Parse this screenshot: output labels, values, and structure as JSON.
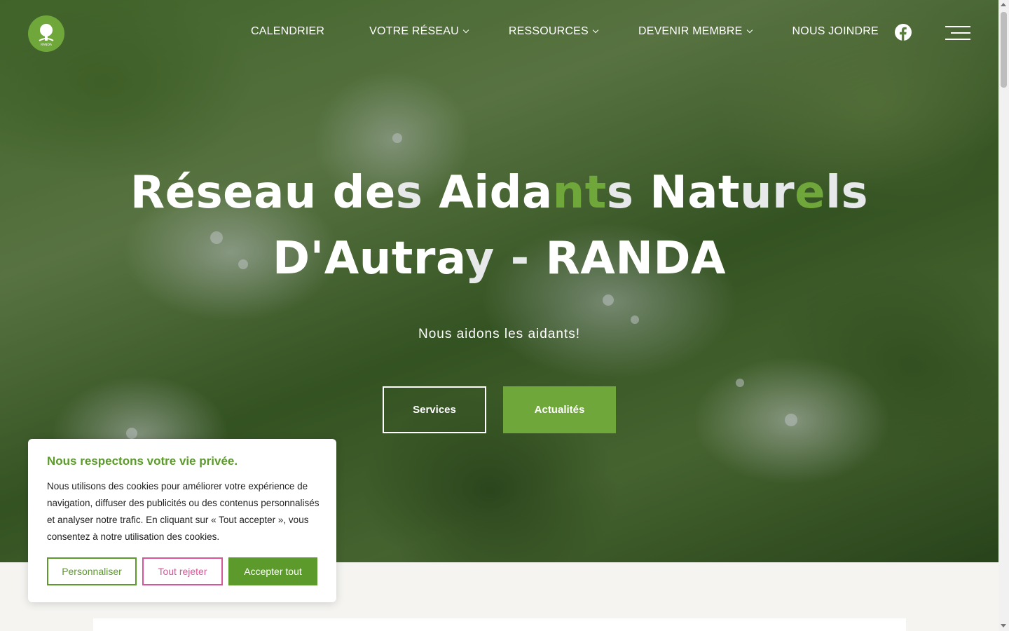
{
  "header": {
    "logo_text": "RANDA",
    "nav": [
      {
        "label": "CALENDRIER",
        "dropdown": false
      },
      {
        "label": "VOTRE RÉSEAU",
        "dropdown": true
      },
      {
        "label": "RESSOURCES",
        "dropdown": true
      },
      {
        "label": "DEVENIR MEMBRE",
        "dropdown": true
      },
      {
        "label": "NOUS JOINDRE",
        "dropdown": false
      }
    ],
    "facebook_icon": "facebook-icon",
    "menu_icon": "hamburger-menu-icon"
  },
  "hero": {
    "title_line1": "Réseau des Aidants Naturels",
    "title_line2": "D'Autray - RANDA",
    "subtitle": "Nous aidons les aidants!",
    "button_services": "Services",
    "button_actualites": "Actualités"
  },
  "cookie": {
    "title": "Nous respectons votre vie privée.",
    "text": "Nous utilisons des cookies pour améliorer votre expérience de navigation, diffuser des publicités ou des contenus personnalisés et analyser notre trafic. En cliquant sur « Tout accepter », vous consentez à notre utilisation des cookies.",
    "customize": "Personnaliser",
    "reject": "Tout rejeter",
    "accept": "Accepter tout"
  },
  "colors": {
    "brand_green": "#6fa73a",
    "reject_pink": "#d9559a"
  }
}
